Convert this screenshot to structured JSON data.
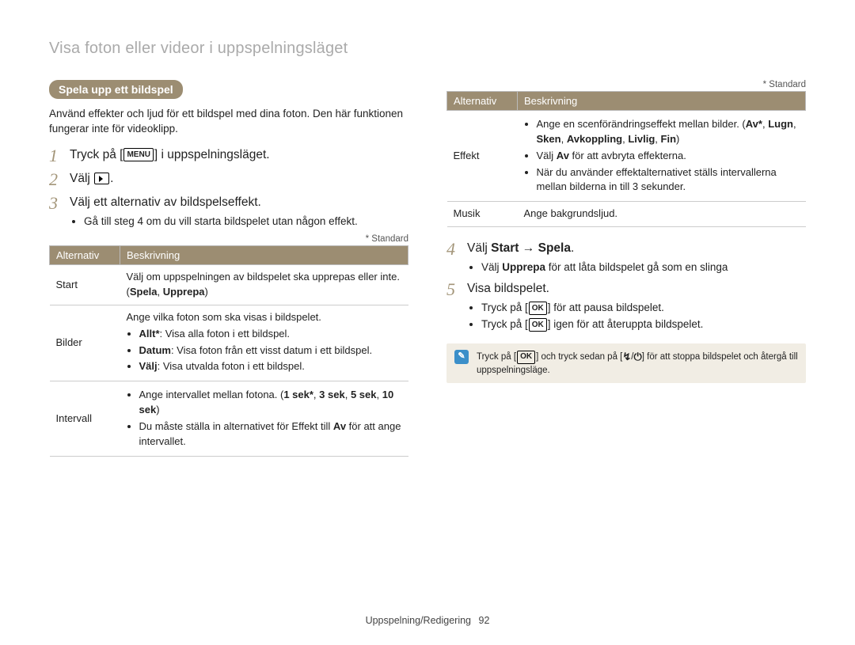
{
  "page_title": "Visa foton eller videor i uppspelningsläget",
  "section_heading": "Spela upp ett bildspel",
  "intro": "Använd effekter och ljud för ett bildspel med dina foton. Den här funktionen fungerar inte för videoklipp.",
  "standard_note": "* Standard",
  "icons": {
    "menu": "MENU",
    "ok": "OK",
    "note_symbol": "✎"
  },
  "steps_left": [
    {
      "num": "1",
      "before": "Tryck på [",
      "icon": "menu",
      "after": "] i uppspelningsläget."
    },
    {
      "num": "2",
      "plain_before": "Välj ",
      "icon": "play",
      "plain_after": "."
    },
    {
      "num": "3",
      "plain": "Välj ett alternativ av bildspelseffekt.",
      "bullets": [
        "Gå till steg 4 om du vill starta bildspelet utan någon effekt."
      ]
    }
  ],
  "table_left": {
    "headers": [
      "Alternativ",
      "Beskrivning"
    ],
    "rows": [
      {
        "key": "Start",
        "desc_html": "Välj om uppspelningen av bildspelet ska upprepas eller inte. (<b>Spela</b>, <b>Upprepa</b>)"
      },
      {
        "key": "Bilder",
        "desc_bullets": [
          "<b>Allt*</b>: Visa alla foton i ett bildspel.",
          "<b>Datum</b>: Visa foton från ett visst datum i ett bildspel.",
          "<b>Välj</b>: Visa utvalda foton i ett bildspel."
        ],
        "desc_lead": "Ange vilka foton som ska visas i bildspelet."
      },
      {
        "key": "Intervall",
        "desc_bullets": [
          "Ange intervallet mellan fotona. (<b>1 sek*</b>, <b>3 sek</b>, <b>5 sek</b>, <b>10 sek</b>)",
          "Du måste ställa in alternativet för Effekt till <b>Av</b> för att ange intervallet."
        ]
      }
    ]
  },
  "table_right": {
    "headers": [
      "Alternativ",
      "Beskrivning"
    ],
    "rows": [
      {
        "key": "Effekt",
        "desc_bullets": [
          "Ange en scenförändringseffekt mellan bilder. (<b>Av*</b>, <b>Lugn</b>, <b>Sken</b>, <b>Avkoppling</b>, <b>Livlig</b>, <b>Fin</b>)",
          "Välj <b>Av</b> för att avbryta effekterna.",
          "När du använder effektalternativet ställs intervallerna mellan bilderna in till 3 sekunder."
        ]
      },
      {
        "key": "Musik",
        "desc_plain": "Ange bakgrundsljud."
      }
    ]
  },
  "steps_right": [
    {
      "num": "4",
      "rich": "Välj <b>Start</b> → <b>Spela</b>.",
      "bullets_rich": [
        "Välj <b>Upprepa</b> för att låta bildspelet gå som en slinga"
      ]
    },
    {
      "num": "5",
      "plain": "Visa bildspelet.",
      "bullets_icon": [
        {
          "before": "Tryck på [",
          "icon": "ok",
          "after": "] för att pausa bildspelet."
        },
        {
          "before": "Tryck på [",
          "icon": "ok",
          "after": "] igen för att återuppta bildspelet."
        }
      ]
    }
  ],
  "note_box": {
    "line1_before": "Tryck på [",
    "icon1": "ok",
    "line1_mid": "] och tryck sedan på [",
    "icon_flash": "↯",
    "sep": "/",
    "icon_power": "⏻",
    "line1_after": "] för att stoppa bildspelet och återgå till uppspelningsläge."
  },
  "footer": {
    "label": "Uppspelning/Redigering",
    "page": "92"
  }
}
